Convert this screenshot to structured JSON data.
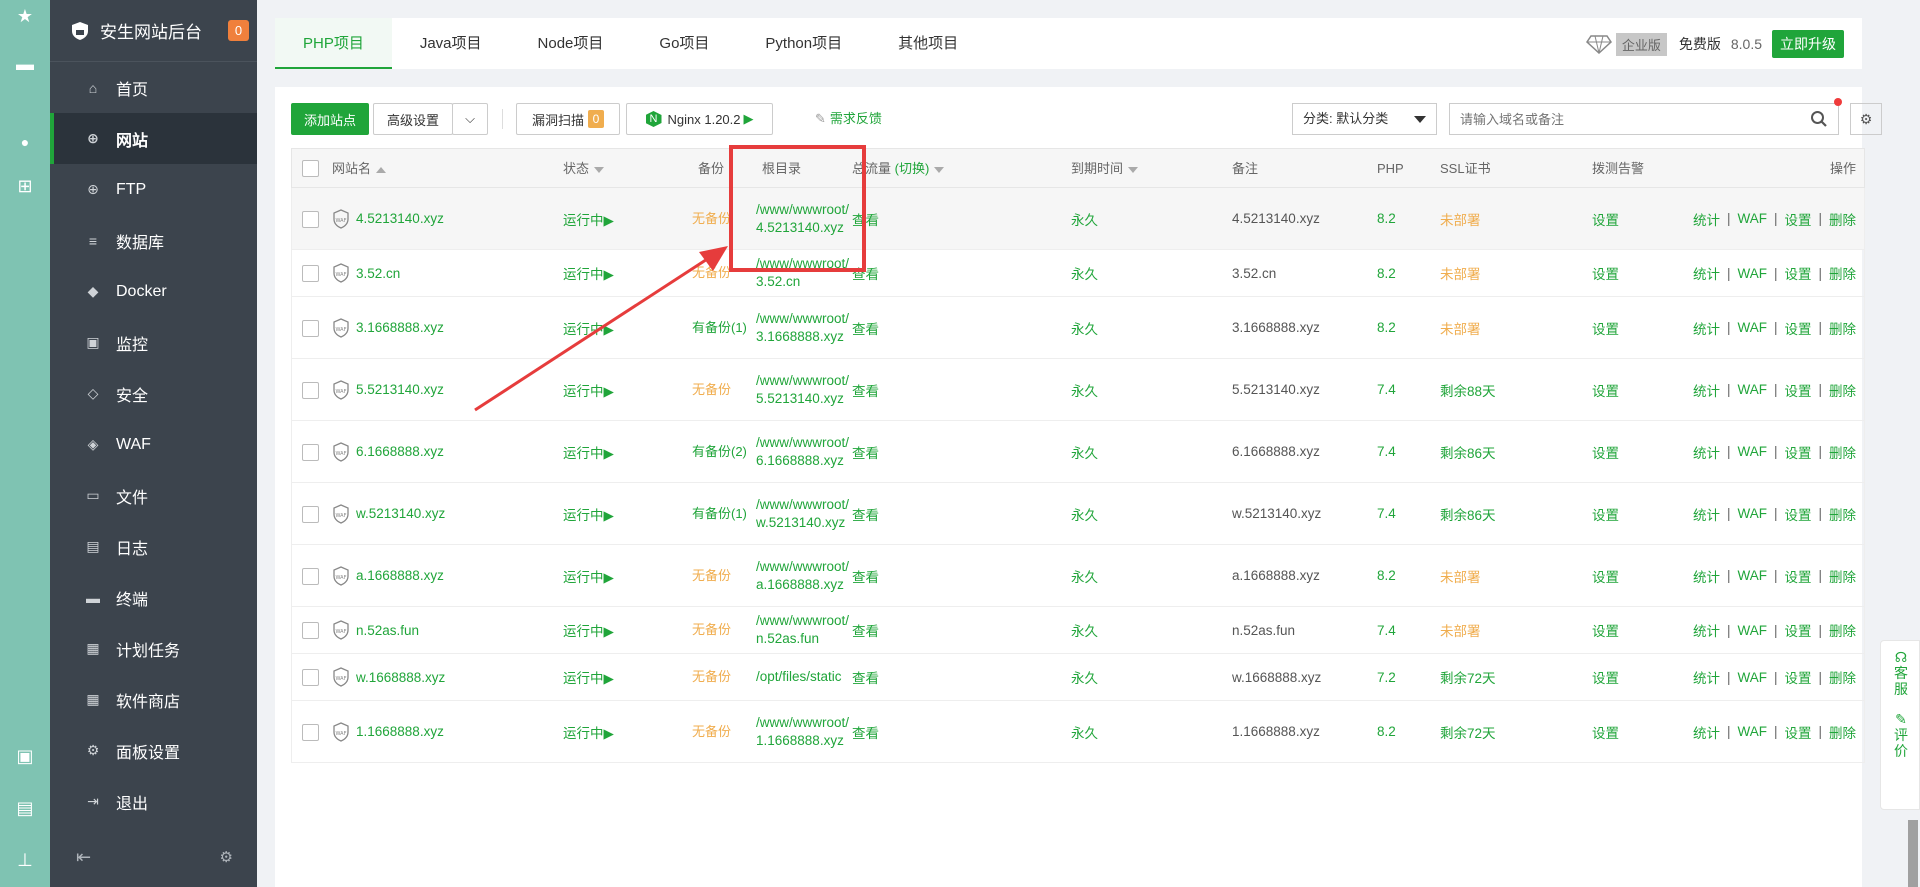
{
  "brand": {
    "title": "安生网站后台",
    "badge": "0"
  },
  "nav": [
    {
      "label": "首页",
      "icon": "home-icon",
      "glyph": "⌂"
    },
    {
      "label": "网站",
      "icon": "globe-icon",
      "glyph": "⊕"
    },
    {
      "label": "FTP",
      "icon": "ftp-globe-icon",
      "glyph": "⊕"
    },
    {
      "label": "数据库",
      "icon": "database-icon",
      "glyph": "≡"
    },
    {
      "label": "Docker",
      "icon": "docker-icon",
      "glyph": "◆"
    },
    {
      "label": "监控",
      "icon": "monitor-icon",
      "glyph": "▣"
    },
    {
      "label": "安全",
      "icon": "shield-icon",
      "glyph": "◇"
    },
    {
      "label": "WAF",
      "icon": "waf-shield-icon",
      "glyph": "◈"
    },
    {
      "label": "文件",
      "icon": "folder-icon",
      "glyph": "▭"
    },
    {
      "label": "日志",
      "icon": "log-icon",
      "glyph": "▤"
    },
    {
      "label": "终端",
      "icon": "terminal-icon",
      "glyph": "▬"
    },
    {
      "label": "计划任务",
      "icon": "calendar-icon",
      "glyph": "▦"
    },
    {
      "label": "软件商店",
      "icon": "apps-icon",
      "glyph": "▦"
    },
    {
      "label": "面板设置",
      "icon": "gear-icon",
      "glyph": "⚙"
    },
    {
      "label": "退出",
      "icon": "logout-icon",
      "glyph": "⇥"
    }
  ],
  "active_nav": "网站",
  "tabs": [
    "PHP项目",
    "Java项目",
    "Node项目",
    "Go项目",
    "Python项目",
    "其他项目"
  ],
  "active_tab": "PHP项目",
  "top_right": {
    "edition": "企业版",
    "free": "免费版",
    "version": "8.0.5",
    "upgrade": "立即升级"
  },
  "toolbar": {
    "add_site": "添加站点",
    "advanced": "高级设置",
    "vuln_scan": "漏洞扫描",
    "vuln_count": "0",
    "nginx": "Nginx 1.20.2",
    "feedback": "需求反馈",
    "category": "分类: 默认分类",
    "search_placeholder": "请输入域名或备注"
  },
  "columns": {
    "name": "网站名",
    "status": "状态",
    "backup": "备份",
    "root": "根目录",
    "traffic": "总流量",
    "traffic_switch": "(切换)",
    "expire": "到期时间",
    "remark": "备注",
    "php": "PHP",
    "ssl": "SSL证书",
    "alert": "拨测告警",
    "ops": "操作"
  },
  "ops_labels": [
    "统计",
    "WAF",
    "设置",
    "删除"
  ],
  "rows": [
    {
      "name": "4.5213140.xyz",
      "status": "运行中▶",
      "backup": "无备份",
      "backup_ok": false,
      "path": "/www/wwwroot/4.5213140.xyz",
      "traffic": "查看",
      "expire": "永久",
      "remark": "4.5213140.xyz",
      "php": "8.2",
      "ssl": "未部署",
      "ssl_ok": false,
      "alert": "设置"
    },
    {
      "name": "3.52.cn",
      "status": "运行中▶",
      "backup": "无备份",
      "backup_ok": false,
      "path": "/www/wwwroot/3.52.cn",
      "traffic": "查看",
      "expire": "永久",
      "remark": "3.52.cn",
      "php": "8.2",
      "ssl": "未部署",
      "ssl_ok": false,
      "alert": "设置"
    },
    {
      "name": "3.1668888.xyz",
      "status": "运行中▶",
      "backup": "有备份(1)",
      "backup_ok": true,
      "path": "/www/wwwroot/3.1668888.xyz",
      "traffic": "查看",
      "expire": "永久",
      "remark": "3.1668888.xyz",
      "php": "8.2",
      "ssl": "未部署",
      "ssl_ok": false,
      "alert": "设置"
    },
    {
      "name": "5.5213140.xyz",
      "status": "运行中▶",
      "backup": "无备份",
      "backup_ok": false,
      "path": "/www/wwwroot/5.5213140.xyz",
      "traffic": "查看",
      "expire": "永久",
      "remark": "5.5213140.xyz",
      "php": "7.4",
      "ssl": "剩余88天",
      "ssl_ok": true,
      "alert": "设置"
    },
    {
      "name": "6.1668888.xyz",
      "status": "运行中▶",
      "backup": "有备份(2)",
      "backup_ok": true,
      "path": "/www/wwwroot/6.1668888.xyz",
      "traffic": "查看",
      "expire": "永久",
      "remark": "6.1668888.xyz",
      "php": "7.4",
      "ssl": "剩余86天",
      "ssl_ok": true,
      "alert": "设置"
    },
    {
      "name": "w.5213140.xyz",
      "status": "运行中▶",
      "backup": "有备份(1)",
      "backup_ok": true,
      "path": "/www/wwwroot/w.5213140.xyz",
      "traffic": "查看",
      "expire": "永久",
      "remark": "w.5213140.xyz",
      "php": "7.4",
      "ssl": "剩余86天",
      "ssl_ok": true,
      "alert": "设置"
    },
    {
      "name": "a.1668888.xyz",
      "status": "运行中▶",
      "backup": "无备份",
      "backup_ok": false,
      "path": "/www/wwwroot/a.1668888.xyz",
      "traffic": "查看",
      "expire": "永久",
      "remark": "a.1668888.xyz",
      "php": "8.2",
      "ssl": "未部署",
      "ssl_ok": false,
      "alert": "设置"
    },
    {
      "name": "n.52as.fun",
      "status": "运行中▶",
      "backup": "无备份",
      "backup_ok": false,
      "path": "/www/wwwroot/n.52as.fun",
      "traffic": "查看",
      "expire": "永久",
      "remark": "n.52as.fun",
      "php": "7.4",
      "ssl": "未部署",
      "ssl_ok": false,
      "alert": "设置"
    },
    {
      "name": "w.1668888.xyz",
      "status": "运行中▶",
      "backup": "无备份",
      "backup_ok": false,
      "path": "/opt/files/static",
      "traffic": "查看",
      "expire": "永久",
      "remark": "w.1668888.xyz",
      "php": "7.2",
      "ssl": "剩余72天",
      "ssl_ok": true,
      "alert": "设置"
    },
    {
      "name": "1.1668888.xyz",
      "status": "运行中▶",
      "backup": "无备份",
      "backup_ok": false,
      "path": "/www/wwwroot/1.1668888.xyz",
      "traffic": "查看",
      "expire": "永久",
      "remark": "1.1668888.xyz",
      "php": "8.2",
      "ssl": "剩余72天",
      "ssl_ok": true,
      "alert": "设置"
    }
  ],
  "float_widget": {
    "service": "客服",
    "review": "评价"
  },
  "colors": {
    "accent": "#20a53a",
    "warning": "#f0ad4e",
    "sidebar": "#3c444d",
    "annotation": "#e63c3c"
  }
}
